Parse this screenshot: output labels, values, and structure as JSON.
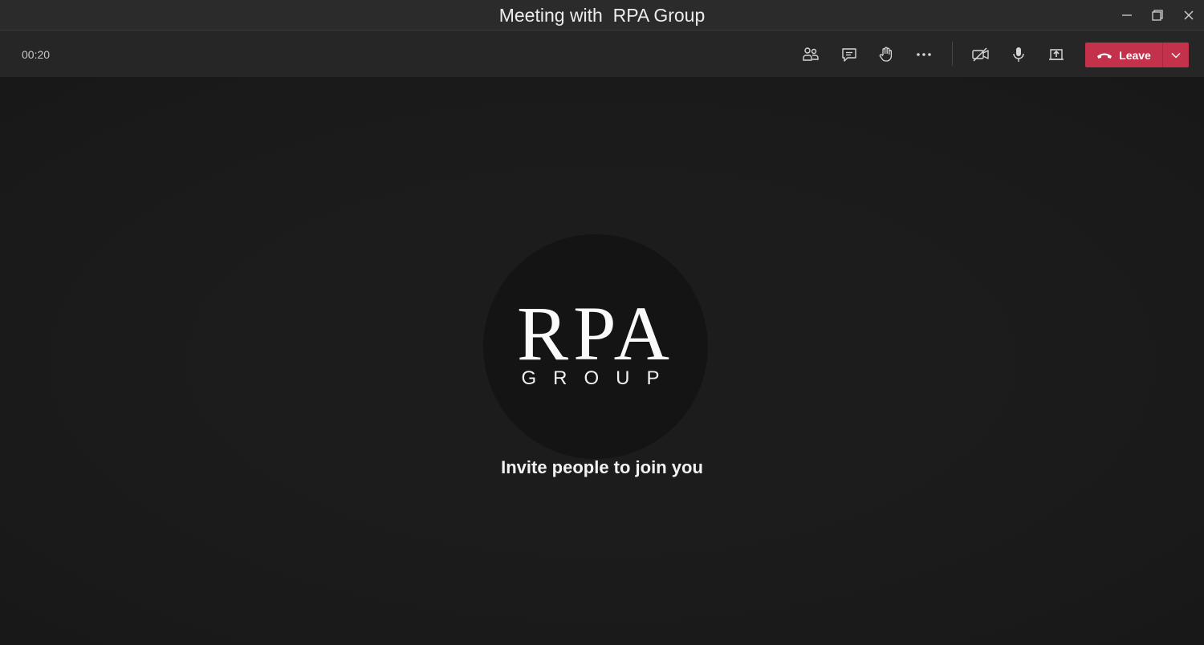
{
  "window": {
    "title": "Meeting with  RPA Group",
    "controls": [
      "minimize-icon",
      "restore-icon",
      "close-icon"
    ]
  },
  "toolbar": {
    "timer": "00:20",
    "buttons": [
      {
        "name": "participants-button",
        "icon": "people-icon"
      },
      {
        "name": "chat-button",
        "icon": "chat-icon"
      },
      {
        "name": "raise-hand-button",
        "icon": "hand-icon"
      },
      {
        "name": "more-actions-button",
        "icon": "ellipsis-icon"
      },
      {
        "name": "camera-toggle-button",
        "icon": "camera-off-icon"
      },
      {
        "name": "mic-toggle-button",
        "icon": "microphone-icon"
      },
      {
        "name": "share-screen-button",
        "icon": "share-tray-icon"
      }
    ],
    "leave_label": "Leave"
  },
  "stage": {
    "logo_main": "RPA",
    "logo_sub": "GROUP",
    "invite_text": "Invite people to join you"
  },
  "colors": {
    "leave": "#c4314b",
    "background": "#1f1f1f",
    "titlebar": "#2b2b2b"
  }
}
